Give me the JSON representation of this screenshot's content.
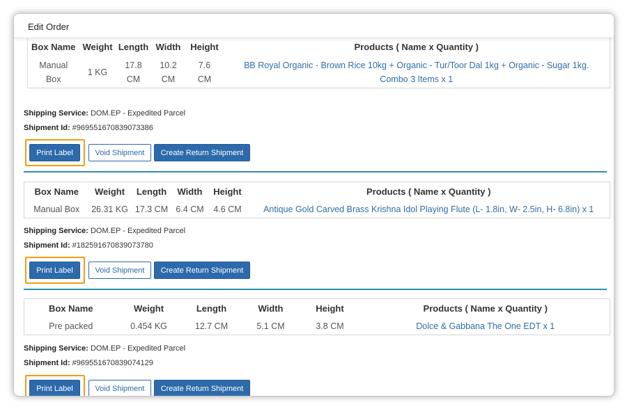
{
  "modal": {
    "title": "Edit Order"
  },
  "columns": {
    "box_name": "Box Name",
    "weight": "Weight",
    "length": "Length",
    "width": "Width",
    "height": "Height",
    "products": "Products ( Name x Quantity )"
  },
  "labels": {
    "shipping_service": "Shipping Service:",
    "shipment_id": "Shipment Id:"
  },
  "buttons": {
    "print_label": "Print Label",
    "void_shipment": "Void Shipment",
    "create_return": "Create Return Shipment"
  },
  "shipments": [
    {
      "box_name": "Manual Box",
      "weight": "1 KG",
      "length": "17.8 CM",
      "width": "10.2 CM",
      "height": "7.6 CM",
      "products": "BB Royal Organic - Brown Rice 10kg + Organic - Tur/Toor Dal 1kg + Organic - Sugar 1kg. Combo 3 Items x 1",
      "service": "DOM.EP - Expedited Parcel",
      "shipment_id": "#969551670839073386"
    },
    {
      "box_name": "Manual Box",
      "weight": "26.31 KG",
      "length": "17.3 CM",
      "width": "6.4 CM",
      "height": "4.6 CM",
      "products": "Antique Gold Carved Brass Krishna Idol Playing Flute (L- 1.8in, W- 2.5in, H- 6.8in) x 1",
      "service": "DOM.EP - Expedited Parcel",
      "shipment_id": "#182591670839073780"
    },
    {
      "box_name": "Pre packed",
      "weight": "0.454 KG",
      "length": "12.7 CM",
      "width": "5.1 CM",
      "height": "3.8 CM",
      "products": "Dolce & Gabbana The One EDT x 1",
      "service": "DOM.EP - Expedited Parcel",
      "shipment_id": "#969551670839074129"
    }
  ],
  "colors": {
    "primary": "#2c6aab",
    "link": "#2f6ea7",
    "highlight": "#f39c12",
    "divider": "#2e8bb3"
  }
}
